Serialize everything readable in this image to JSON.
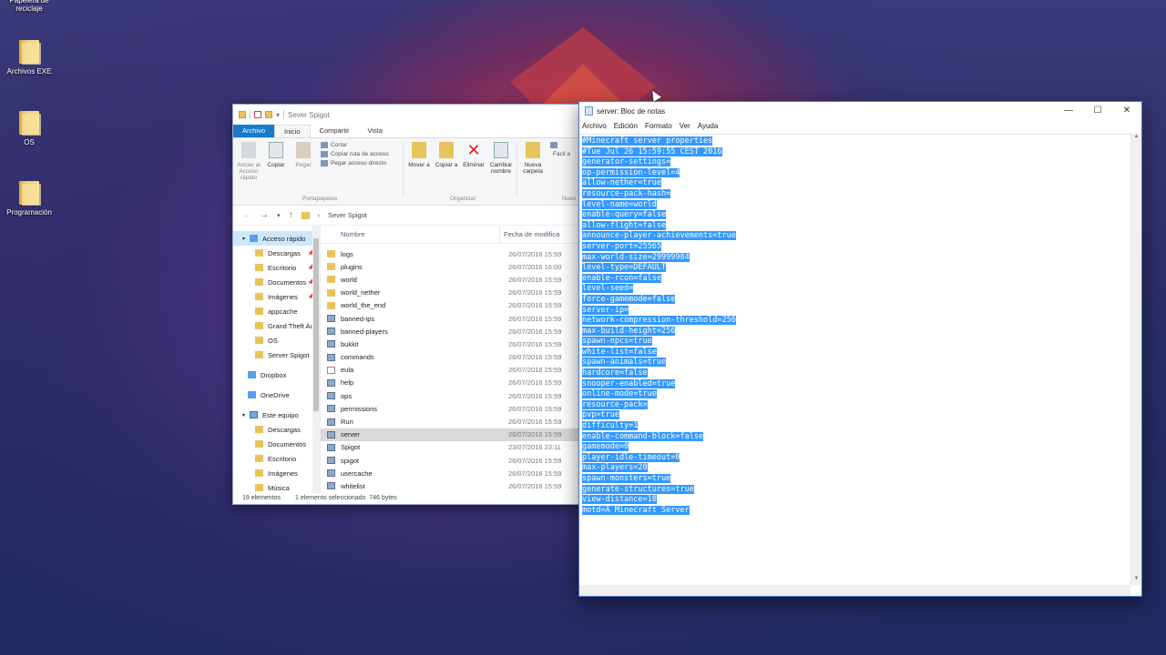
{
  "desktop": {
    "icons": [
      {
        "label": "Papelera de reciclaje"
      },
      {
        "label": "Archivos EXE"
      },
      {
        "label": "OS"
      },
      {
        "label": "Programación"
      }
    ]
  },
  "explorer": {
    "title": "Sever Spigot",
    "tabs": [
      "Archivo",
      "Inicio",
      "Compartir",
      "Vista"
    ],
    "ribbon": {
      "pin_label": "Anclar al Acceso rápido",
      "copy_label": "Copiar",
      "paste_label": "Pegar",
      "cut_label": "Cortar",
      "copy_path_label": "Copiar ruta de acceso",
      "paste_shortcut_label": "Pegar acceso directo",
      "clipboard_group": "Portapapeles",
      "move_label": "Mover a",
      "copy_to_label": "Copiar a",
      "delete_label": "Eliminar",
      "rename_label": "Cambiar nombre",
      "organize_group": "Organizar",
      "new_folder_label": "Nueva carpeta",
      "new_group": "Nuev",
      "easy_access_label": "Fácil a"
    },
    "address": {
      "path": "Sever Spigot"
    },
    "nav": {
      "quick_access": "Acceso rápido",
      "quick_items": [
        "Descargas",
        "Escritorio",
        "Documentos",
        "Imágenes",
        "appcache",
        "Grand Theft Auto",
        "OS",
        "Server Spigot"
      ],
      "dropbox": "Dropbox",
      "onedrive": "OneDrive",
      "this_pc": "Este equipo",
      "pc_items": [
        "Descargas",
        "Documentos",
        "Escritorio",
        "Imágenes",
        "Música",
        "Vídeos"
      ]
    },
    "columns": {
      "name": "Nombre",
      "date": "Fecha de modifica"
    },
    "files": [
      {
        "name": "logs",
        "date": "26/07/2016 15:59",
        "kind": "folder"
      },
      {
        "name": "plugins",
        "date": "26/07/2016 16:00",
        "kind": "folder"
      },
      {
        "name": "world",
        "date": "26/07/2016 15:59",
        "kind": "folder"
      },
      {
        "name": "world_nether",
        "date": "26/07/2016 15:59",
        "kind": "folder"
      },
      {
        "name": "world_the_end",
        "date": "26/07/2016 15:59",
        "kind": "folder"
      },
      {
        "name": "banned-ips",
        "date": "26/07/2016 15:59",
        "kind": "app"
      },
      {
        "name": "banned-players",
        "date": "26/07/2016 15:59",
        "kind": "app"
      },
      {
        "name": "bukkit",
        "date": "26/07/2016 15:59",
        "kind": "app"
      },
      {
        "name": "commands",
        "date": "26/07/2016 15:59",
        "kind": "app"
      },
      {
        "name": "eula",
        "date": "26/07/2016 15:59",
        "kind": "doc"
      },
      {
        "name": "help",
        "date": "26/07/2016 15:59",
        "kind": "app"
      },
      {
        "name": "ops",
        "date": "26/07/2016 15:59",
        "kind": "app"
      },
      {
        "name": "permissions",
        "date": "26/07/2016 15:59",
        "kind": "app"
      },
      {
        "name": "Run",
        "date": "26/07/2016 15:59",
        "kind": "app"
      },
      {
        "name": "server",
        "date": "26/07/2016 15:59",
        "kind": "app"
      },
      {
        "name": "Spigot",
        "date": "23/07/2016 23:11",
        "kind": "app"
      },
      {
        "name": "spigot",
        "date": "26/07/2016 15:59",
        "kind": "app"
      },
      {
        "name": "usercache",
        "date": "26/07/2016 15:59",
        "kind": "app"
      },
      {
        "name": "whitelist",
        "date": "26/07/2016 15:59",
        "kind": "app"
      }
    ],
    "selected_file": "server",
    "status": {
      "count": "19 elementos",
      "selection": "1 elemento seleccionado  746 bytes"
    }
  },
  "notepad": {
    "title": "server: Bloc de notas",
    "menu": [
      "Archivo",
      "Edición",
      "Formato",
      "Ver",
      "Ayuda"
    ],
    "lines": [
      "#Minecraft server properties",
      "#Tue Jul 26 15:59:55 CEST 2016",
      "generator-settings=",
      "op-permission-level=4",
      "allow-nether=true",
      "resource-pack-hash=",
      "level-name=world",
      "enable-query=false",
      "allow-flight=false",
      "announce-player-achievements=true",
      "server-port=25565",
      "max-world-size=29999984",
      "level-type=DEFAULT",
      "enable-rcon=false",
      "level-seed=",
      "force-gamemode=false",
      "server-ip=",
      "network-compression-threshold=256",
      "max-build-height=256",
      "spawn-npcs=true",
      "white-list=false",
      "spawn-animals=true",
      "hardcore=false",
      "snooper-enabled=true",
      "online-mode=true",
      "resource-pack=",
      "pvp=true",
      "difficulty=1",
      "enable-command-block=false",
      "gamemode=0",
      "player-idle-timeout=0",
      "max-players=20",
      "spawn-monsters=true",
      "generate-structures=true",
      "view-distance=10",
      "motd=A Minecraft Server"
    ],
    "controls": {
      "minimize": "—",
      "maximize": "☐",
      "close": "✕"
    }
  }
}
